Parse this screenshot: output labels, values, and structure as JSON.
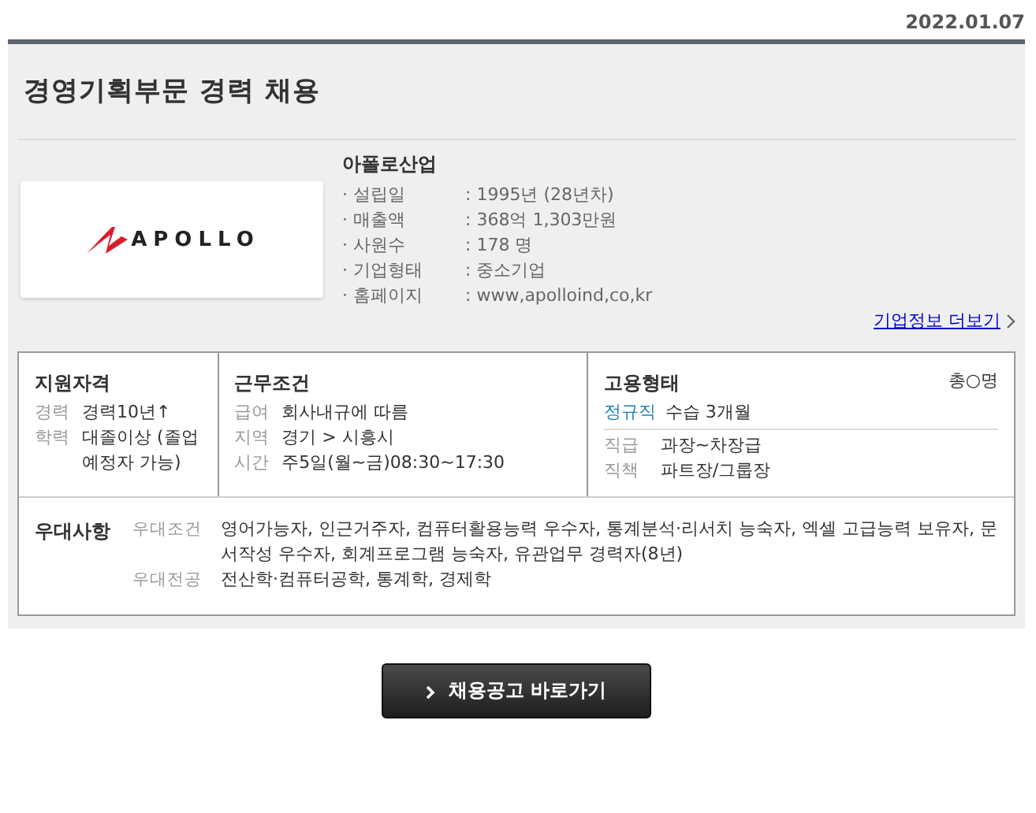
{
  "date": "2022.01.07",
  "title": "경영기획부문 경력 채용",
  "company": {
    "name": "아폴로산업",
    "logo_text": "APOLLO",
    "facts": [
      {
        "label": "· 설립일",
        "value": ": 1995년 (28년차)"
      },
      {
        "label": "· 매출액",
        "value": ": 368억 1,303만원"
      },
      {
        "label": "· 사원수",
        "value": ": 178 명"
      },
      {
        "label": "· 기업형태",
        "value": ": 중소기업"
      },
      {
        "label": "· 홈페이지",
        "value": ": www,apolloind,co,kr"
      }
    ],
    "more_link": "기업정보 더보기"
  },
  "qualification": {
    "heading": "지원자격",
    "rows": [
      {
        "label": "경력",
        "value": "경력10년↑"
      },
      {
        "label": "학력",
        "value": "대졸이상 (졸업예정자 가능)"
      }
    ]
  },
  "conditions": {
    "heading": "근무조건",
    "rows": [
      {
        "label": "급여",
        "value": "회사내규에 따름"
      },
      {
        "label": "지역",
        "value": "경기 > 시흥시"
      },
      {
        "label": "시간",
        "value": "주5일(월~금)08:30~17:30"
      }
    ]
  },
  "employment": {
    "heading": "고용형태",
    "headcount": "총○명",
    "type": "정규직",
    "type_note": "수습 3개월",
    "rows": [
      {
        "label": "직급",
        "value": "과장~차장급"
      },
      {
        "label": "직책",
        "value": "파트장/그룹장"
      }
    ]
  },
  "preferences": {
    "heading": "우대사항",
    "rows": [
      {
        "label": "우대조건",
        "value": "영어가능자, 인근거주자, 컴퓨터활용능력 우수자, 통계분석·리서치 능숙자, 엑셀 고급능력 보유자, 문서작성 우수자, 회계프로그램 능숙자, 유관업무 경력자(8년)"
      },
      {
        "label": "우대전공",
        "value": "전산학·컴퓨터공학, 통계학, 경제학"
      }
    ]
  },
  "apply_button": "채용공고 바로가기"
}
